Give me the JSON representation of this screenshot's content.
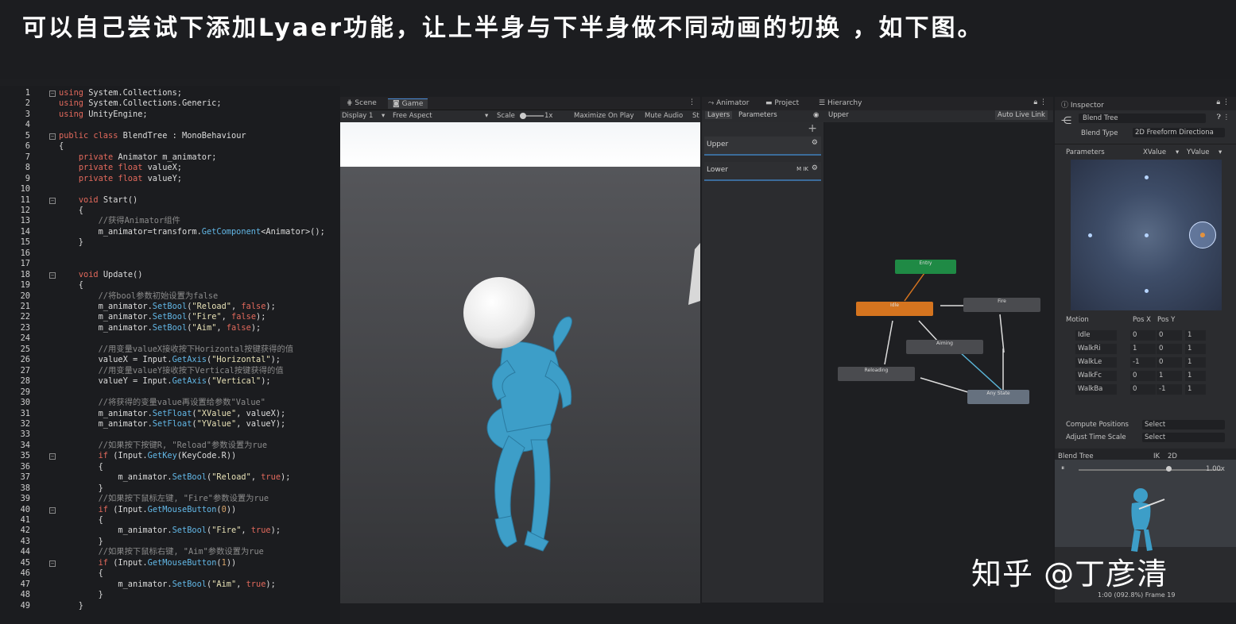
{
  "banner": {
    "text": "可以自己尝试下添加Lyaer功能，让上半身与下半身做不同动画的切换 ，如下图。"
  },
  "code": {
    "lines": [
      {
        "n": "1",
        "fold": "-",
        "html": "<span class='kw'>using</span> System.Collections;"
      },
      {
        "n": "2",
        "fold": "",
        "html": "<span class='kw'>using</span> System.Collections.Generic;"
      },
      {
        "n": "3",
        "fold": "",
        "html": "<span class='kw'>using</span> UnityEngine;"
      },
      {
        "n": "4",
        "fold": "",
        "html": ""
      },
      {
        "n": "5",
        "fold": "-",
        "html": "<span class='kw'>public class</span> BlendTree : MonoBehaviour"
      },
      {
        "n": "6",
        "fold": "",
        "html": "{"
      },
      {
        "n": "7",
        "fold": "",
        "html": "    <span class='kw'>private</span> Animator m_animator;"
      },
      {
        "n": "8",
        "fold": "",
        "html": "    <span class='kw'>private float</span> valueX;"
      },
      {
        "n": "9",
        "fold": "",
        "html": "    <span class='kw'>private float</span> valueY;"
      },
      {
        "n": "10",
        "fold": "",
        "html": ""
      },
      {
        "n": "11",
        "fold": "-",
        "html": "    <span class='kw'>void</span> Start()"
      },
      {
        "n": "12",
        "fold": "",
        "html": "    {"
      },
      {
        "n": "13",
        "fold": "",
        "html": "        <span class='cm'>//获得Animator组件</span>"
      },
      {
        "n": "14",
        "fold": "",
        "html": "        m_animator=transform.<span class='mt'>GetComponent</span>&lt;Animator&gt;();"
      },
      {
        "n": "15",
        "fold": "",
        "html": "    }"
      },
      {
        "n": "16",
        "fold": "",
        "html": ""
      },
      {
        "n": "17",
        "fold": "",
        "html": ""
      },
      {
        "n": "18",
        "fold": "-",
        "html": "    <span class='kw'>void</span> Update()"
      },
      {
        "n": "19",
        "fold": "",
        "html": "    {"
      },
      {
        "n": "20",
        "fold": "",
        "html": "        <span class='cm'>//将bool参数初始设置为false</span>"
      },
      {
        "n": "21",
        "fold": "",
        "html": "        m_animator.<span class='mt'>SetBool</span>(<span class='st'>\"Reload\"</span>, <span class='kw'>false</span>);"
      },
      {
        "n": "22",
        "fold": "",
        "html": "        m_animator.<span class='mt'>SetBool</span>(<span class='st'>\"Fire\"</span>, <span class='kw'>false</span>);"
      },
      {
        "n": "23",
        "fold": "",
        "html": "        m_animator.<span class='mt'>SetBool</span>(<span class='st'>\"Aim\"</span>, <span class='kw'>false</span>);"
      },
      {
        "n": "24",
        "fold": "",
        "html": ""
      },
      {
        "n": "25",
        "fold": "",
        "html": "        <span class='cm'>//用变量valueX接收按下Horizontal按键获得的值</span>"
      },
      {
        "n": "26",
        "fold": "",
        "html": "        valueX = Input.<span class='mt'>GetAxis</span>(<span class='st'>\"Horizontal\"</span>);"
      },
      {
        "n": "27",
        "fold": "",
        "html": "        <span class='cm'>//用变量valueY接收按下Vertical按键获得的值</span>"
      },
      {
        "n": "28",
        "fold": "",
        "html": "        valueY = Input.<span class='mt'>GetAxis</span>(<span class='st'>\"Vertical\"</span>);"
      },
      {
        "n": "29",
        "fold": "",
        "html": ""
      },
      {
        "n": "30",
        "fold": "",
        "html": "        <span class='cm'>//将获得的变量value再设置给参数\"Value\"</span>"
      },
      {
        "n": "31",
        "fold": "",
        "html": "        m_animator.<span class='mt'>SetFloat</span>(<span class='st'>\"XValue\"</span>, valueX);"
      },
      {
        "n": "32",
        "fold": "",
        "html": "        m_animator.<span class='mt'>SetFloat</span>(<span class='st'>\"YValue\"</span>, valueY);"
      },
      {
        "n": "33",
        "fold": "",
        "html": ""
      },
      {
        "n": "34",
        "fold": "",
        "html": "        <span class='cm'>//如果按下按键R, \"Reload\"参数设置为rue</span>"
      },
      {
        "n": "35",
        "fold": "-",
        "html": "        <span class='kw'>if</span> (Input.<span class='mt'>GetKey</span>(KeyCode.R))"
      },
      {
        "n": "36",
        "fold": "",
        "html": "        {"
      },
      {
        "n": "37",
        "fold": "",
        "html": "            m_animator.<span class='mt'>SetBool</span>(<span class='st'>\"Reload\"</span>, <span class='kw'>true</span>);"
      },
      {
        "n": "38",
        "fold": "",
        "html": "        }"
      },
      {
        "n": "39",
        "fold": "",
        "html": "        <span class='cm'>//如果按下鼠标左键, \"Fire\"参数设置为rue</span>"
      },
      {
        "n": "40",
        "fold": "-",
        "html": "        <span class='kw'>if</span> (Input.<span class='mt'>GetMouseButton</span>(<span class='nm'>0</span>))"
      },
      {
        "n": "41",
        "fold": "",
        "html": "        {"
      },
      {
        "n": "42",
        "fold": "",
        "html": "            m_animator.<span class='mt'>SetBool</span>(<span class='st'>\"Fire\"</span>, <span class='kw'>true</span>);"
      },
      {
        "n": "43",
        "fold": "",
        "html": "        }"
      },
      {
        "n": "44",
        "fold": "",
        "html": "        <span class='cm'>//如果按下鼠标右键, \"Aim\"参数设置为rue</span>"
      },
      {
        "n": "45",
        "fold": "-",
        "html": "        <span class='kw'>if</span> (Input.<span class='mt'>GetMouseButton</span>(<span class='nm'>1</span>))"
      },
      {
        "n": "46",
        "fold": "",
        "html": "        {"
      },
      {
        "n": "47",
        "fold": "",
        "html": "            m_animator.<span class='mt'>SetBool</span>(<span class='st'>\"Aim\"</span>, <span class='kw'>true</span>);"
      },
      {
        "n": "48",
        "fold": "",
        "html": "        }"
      },
      {
        "n": "49",
        "fold": "",
        "html": "    }"
      }
    ]
  },
  "game": {
    "tabs": [
      "Scene",
      "Game"
    ],
    "display": "Display 1",
    "aspect": "Free Aspect",
    "scale_label": "Scale",
    "scale_value": "1x",
    "maximize": "Maximize On Play",
    "mute": "Mute Audio",
    "stats": "St"
  },
  "animator": {
    "tabs": [
      "Animator",
      "Project",
      "Hierarchy"
    ],
    "subtabs": [
      "Layers",
      "Parameters"
    ],
    "breadcrumb": "Upper",
    "auto_live": "Auto Live Link",
    "layers": [
      {
        "name": "Upper",
        "flags": ""
      },
      {
        "name": "Lower",
        "flags": "M IK"
      }
    ],
    "states": [
      "Entry",
      "Idle",
      "Fire",
      "Aiming",
      "Reloading",
      "Any State"
    ]
  },
  "inspector": {
    "tab": "Inspector",
    "object": "Blend Tree",
    "blend_type_label": "Blend Type",
    "blend_type": "2D Freeform Directiona",
    "parameters_label": "Parameters",
    "param_x": "XValue",
    "param_y": "YValue",
    "motion_header": [
      "Motion",
      "Pos X",
      "Pos Y"
    ],
    "motions": [
      {
        "name": "Idle",
        "x": "0",
        "y": "0",
        "s": "1"
      },
      {
        "name": "WalkRi",
        "x": "1",
        "y": "0",
        "s": "1"
      },
      {
        "name": "WalkLe",
        "x": "-1",
        "y": "0",
        "s": "1"
      },
      {
        "name": "WalkFc",
        "x": "0",
        "y": "1",
        "s": "1"
      },
      {
        "name": "WalkBa",
        "x": "0",
        "y": "-1",
        "s": "1"
      }
    ],
    "compute_label": "Compute Positions",
    "compute_value": "Select",
    "adjust_label": "Adjust Time Scale",
    "adjust_value": "Select",
    "preview_title": "Blend Tree",
    "preview_ik": "IK",
    "preview_2d": "2D",
    "preview_speed": "1.00x",
    "preview_frame": "1:00 (092.8%) Frame 19"
  },
  "watermark": "知乎 @丁彦清",
  "colors": {
    "accent": "#4a8bd6",
    "idle_state": "#d5741f",
    "entry_state": "#1f8a45"
  }
}
